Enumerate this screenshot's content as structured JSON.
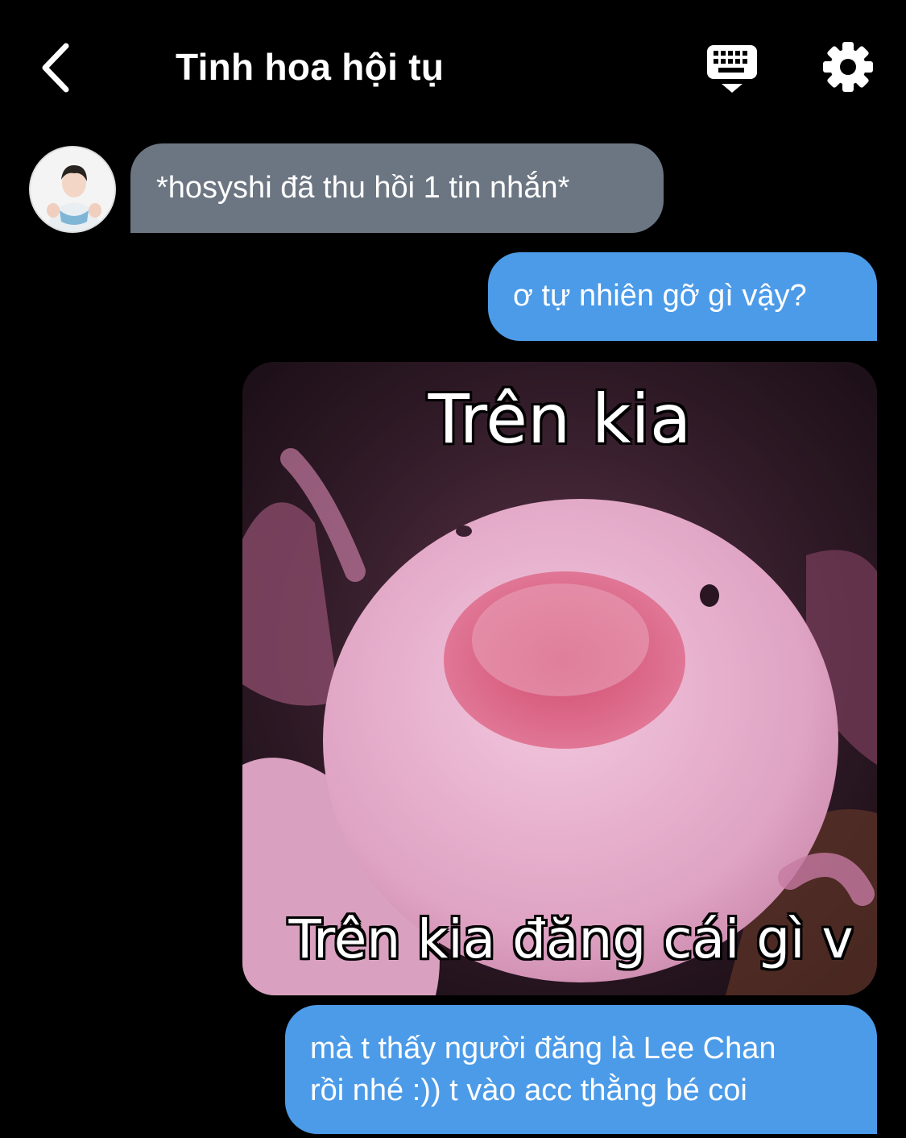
{
  "header": {
    "title": "Tinh hoa hội tụ",
    "back_icon": "chevron-left-icon",
    "keyboard_icon": "keyboard-hide-icon",
    "settings_icon": "gear-icon"
  },
  "messages": [
    {
      "side": "incoming",
      "text": "*hosyshi đã thu hồi 1 tin nhắn*",
      "color": "#6c7682"
    },
    {
      "side": "outgoing",
      "text": "ơ tự nhiên gỡ gì vậy?",
      "color": "#4c9be8"
    },
    {
      "side": "outgoing",
      "type": "image",
      "caption_top": "Trên kia",
      "caption_bottom": "Trên kia đăng cái gì v"
    },
    {
      "side": "outgoing",
      "lines": [
        "mà t thấy người đăng là Lee Chan",
        "rồi nhé :)) t vào acc thằng bé coi"
      ],
      "color": "#4c9be8"
    }
  ],
  "colors": {
    "background": "#000000",
    "incoming_bubble": "#6c7682",
    "outgoing_bubble": "#4c9be8"
  }
}
